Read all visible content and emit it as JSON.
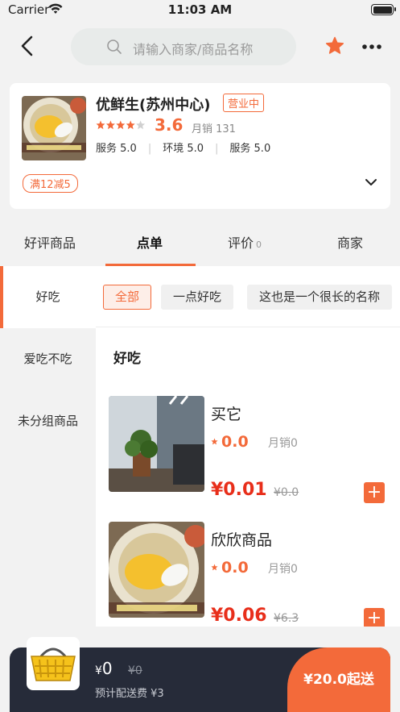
{
  "status_bar": {
    "carrier": "Carrier",
    "time": "11:03 AM"
  },
  "header": {
    "search_placeholder": "请输入商家/商品名称"
  },
  "store": {
    "name": "优鲜生(苏州中心)",
    "status": "营业中",
    "stars": 4,
    "rating": "3.6",
    "monthly_sales": "月销 131",
    "scores": [
      "服务 5.0",
      "环境 5.0",
      "服务 5.0"
    ],
    "promo": "满12减5"
  },
  "tabs": [
    {
      "label": "好评商品"
    },
    {
      "label": "点单",
      "active": true
    },
    {
      "label": "评价",
      "count": "0"
    },
    {
      "label": "商家"
    }
  ],
  "categories": [
    {
      "label": "好吃",
      "active": true
    },
    {
      "label": "爱吃不吃"
    },
    {
      "label": "未分组商品"
    }
  ],
  "filters": [
    {
      "label": "全部",
      "active": true
    },
    {
      "label": "一点好吃"
    },
    {
      "label": "这也是一个很长的名称"
    }
  ],
  "group_title": "好吃",
  "products": [
    {
      "name": "买它",
      "rating": "0.0",
      "sales": "月销0",
      "price": "¥0.01",
      "old_price": "¥0.0"
    },
    {
      "name": "欣欣商品",
      "rating": "0.0",
      "sales": "月销0",
      "price": "¥0.06",
      "old_price": "¥6.3"
    }
  ],
  "cart": {
    "currency": "¥",
    "total": "0",
    "old_total": "¥0",
    "delivery_fee": "预计配送费  ¥3",
    "checkout": "¥20.0起送"
  },
  "colors": {
    "accent": "#f36a3a",
    "price": "#e82e1a",
    "cart_bg": "#262b39"
  }
}
